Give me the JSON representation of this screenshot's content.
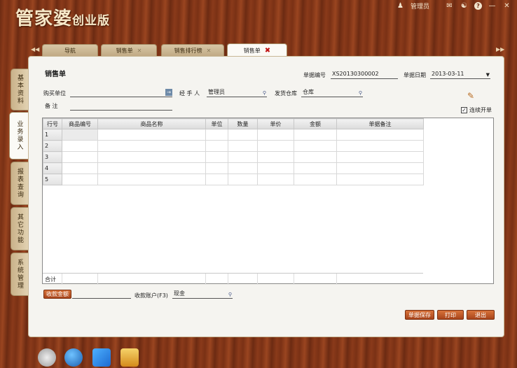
{
  "app": {
    "logo_main": "管家婆",
    "logo_sub": "创业版",
    "user": "管理员"
  },
  "tabs": [
    {
      "label": "导航"
    },
    {
      "label": "销售单"
    },
    {
      "label": "销售排行榜"
    },
    {
      "label": "销售单"
    }
  ],
  "sidebar": [
    {
      "label": "基本资料"
    },
    {
      "label": "业务录入"
    },
    {
      "label": "报表查询"
    },
    {
      "label": "其它功能"
    },
    {
      "label": "系统管理"
    }
  ],
  "form": {
    "title": "销售单",
    "doc_no_label": "单据编号",
    "doc_no": "XS20130300002",
    "doc_date_label": "单据日期",
    "doc_date": "2013-03-11",
    "buyer_label": "购买单位",
    "buyer": "",
    "handler_label": "经 手 人",
    "handler": "管理员",
    "warehouse_label": "发货仓库",
    "warehouse": "仓库",
    "remark_label": "备    注",
    "remark": "",
    "continuous_label": "连续开单",
    "continuous_checked": true
  },
  "grid": {
    "columns": [
      "行号",
      "商品编号",
      "商品名称",
      "单位",
      "数量",
      "单价",
      "金额",
      "单据备注"
    ],
    "rows": [
      "1",
      "2",
      "3",
      "4",
      "5"
    ],
    "total_label": "合计"
  },
  "bottom": {
    "receive_amount": "收款金额",
    "account_label": "收款账户(F3)",
    "account": "现金"
  },
  "buttons": {
    "save": "单据保存",
    "print": "打印",
    "exit": "退出"
  },
  "colors": {
    "wood": "#7a3115",
    "accent": "#b84d20",
    "panel": "#f5f4f0"
  }
}
